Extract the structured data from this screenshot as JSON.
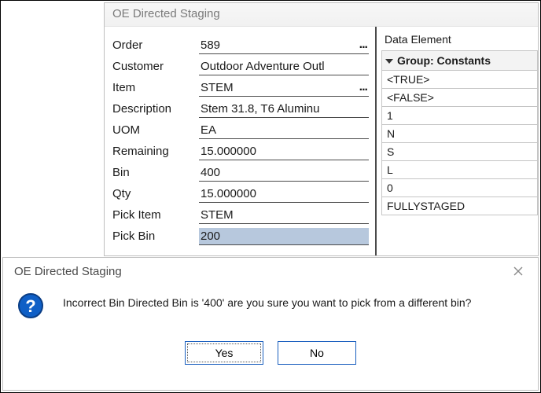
{
  "window": {
    "title": "OE Directed Staging"
  },
  "form": {
    "fields": [
      {
        "label": "Order",
        "value": "589",
        "lookup": true
      },
      {
        "label": "Customer",
        "value": "Outdoor Adventure Outl",
        "lookup": false
      },
      {
        "label": "Item",
        "value": "STEM",
        "lookup": true
      },
      {
        "label": "Description",
        "value": "Stem 31.8, T6 Aluminu",
        "lookup": false
      },
      {
        "label": "UOM",
        "value": "EA",
        "lookup": false
      },
      {
        "label": "Remaining",
        "value": "15.000000",
        "lookup": false
      },
      {
        "label": "Bin",
        "value": "400",
        "lookup": false
      },
      {
        "label": "Qty",
        "value": "15.000000",
        "lookup": false
      },
      {
        "label": "Pick Item",
        "value": "STEM",
        "lookup": false
      },
      {
        "label": "Pick Bin",
        "value": "200",
        "lookup": false,
        "highlight": true
      }
    ]
  },
  "side": {
    "header": "Data Element",
    "group_label": "Group: Constants",
    "items": [
      "<TRUE>",
      "<FALSE>",
      "1",
      "N",
      "S",
      "L",
      "0",
      "FULLYSTAGED"
    ]
  },
  "dialog": {
    "title": "OE Directed Staging",
    "message": "Incorrect Bin Directed Bin is '400' are you sure you want to pick from a different bin?",
    "yes": "Yes",
    "no": "No"
  }
}
